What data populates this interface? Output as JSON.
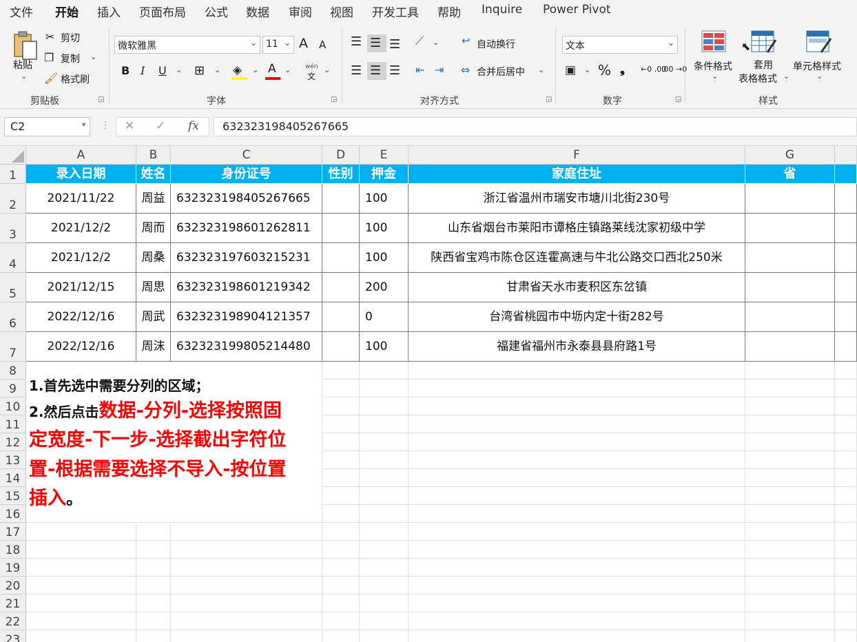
{
  "menu": {
    "items": [
      "文件",
      "开始",
      "插入",
      "页面布局",
      "公式",
      "数据",
      "审阅",
      "视图",
      "开发工具",
      "帮助",
      "Inquire",
      "Power Pivot"
    ],
    "active": "开始"
  },
  "ribbon": {
    "clipboard": {
      "label": "剪贴板",
      "paste": "粘贴",
      "cut": "剪切",
      "copy": "复制",
      "format_painter": "格式刷"
    },
    "font": {
      "label": "字体",
      "family": "微软雅黑",
      "size": "11",
      "bold": "B",
      "italic": "I",
      "underline": "U",
      "grow": "A",
      "shrink": "A",
      "color_letter": "A",
      "phonetic_top": "wén",
      "phonetic_bottom": "文"
    },
    "alignment": {
      "label": "对齐方式",
      "wrap_text": "自动换行",
      "merge_center": "合并后居中"
    },
    "number": {
      "label": "数字",
      "format": "文本",
      "percent": "%",
      "comma": "❟",
      "inc_decimal": "←0 .00",
      "dec_decimal": ".00 →0"
    },
    "styles": {
      "label": "样式",
      "conditional": "条件格式",
      "table_line1": "套用",
      "table_line2": "表格格式",
      "cell_styles": "单元格样式"
    }
  },
  "formula_bar": {
    "name_box": "C2",
    "fx": "fx",
    "value": "632323198405267665"
  },
  "sheet": {
    "columns": [
      "A",
      "B",
      "C",
      "D",
      "E",
      "F",
      "G"
    ],
    "rows": [
      "1",
      "2",
      "3",
      "4",
      "5",
      "6",
      "7",
      "8",
      "9",
      "10",
      "11",
      "12",
      "13",
      "14",
      "15",
      "16",
      "17",
      "18",
      "19",
      "20",
      "21",
      "22",
      "23"
    ],
    "headers": [
      "录入日期",
      "姓名",
      "身份证号",
      "性别",
      "押金",
      "家庭住址",
      "省"
    ],
    "data": [
      [
        "2021/11/22",
        "周益",
        "632323198405267665",
        "",
        "100",
        "浙江省温州市瑞安市塘川北街230号",
        ""
      ],
      [
        "2021/12/2",
        "周而",
        "632323198601262811",
        "",
        "100",
        "山东省烟台市莱阳市谭格庄镇路莱线沈家初级中学",
        ""
      ],
      [
        "2021/12/2",
        "周桑",
        "632323197603215231",
        "",
        "100",
        "陕西省宝鸡市陈仓区连霍高速与牛北公路交口西北250米",
        ""
      ],
      [
        "2021/12/15",
        "周思",
        "632323198601219342",
        "",
        "200",
        "甘肃省天水市麦积区东岔镇",
        ""
      ],
      [
        "2022/12/16",
        "周武",
        "632323198904121357",
        "",
        "0",
        "台湾省桃园市中坜内定十街282号",
        ""
      ],
      [
        "2022/12/16",
        "周沫",
        "632323199805214480",
        "",
        "100",
        "福建省福州市永泰县县府路1号",
        ""
      ]
    ]
  },
  "note": {
    "line1": "1.首先选中需要分列的区域；",
    "line2_prefix": "2.然后点击",
    "line2_red": "数据-分列-选择按照固",
    "line3": "定宽度-下一步-选择截出字符位",
    "line4": "置-根据需要选择不导入-按位置",
    "line5_red": "插入",
    "line5_end": "。"
  }
}
